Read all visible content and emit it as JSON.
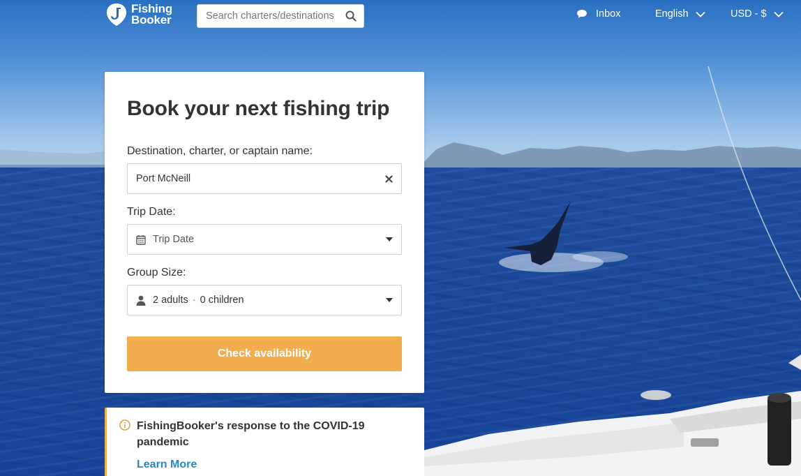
{
  "header": {
    "logo_line1": "Fishing",
    "logo_line2": "Booker",
    "search_placeholder": "Search charters/destinations",
    "inbox_label": "Inbox",
    "language_label": "English",
    "currency_label": "USD - $"
  },
  "booking": {
    "title": "Book your next fishing trip",
    "destination_label": "Destination, charter, or captain name:",
    "destination_value": "Port McNeill",
    "date_label": "Trip Date:",
    "date_placeholder": "Trip Date",
    "group_label": "Group Size:",
    "adults_text": "2 adults",
    "separator": "·",
    "children_text": "0 children",
    "check_button": "Check availability"
  },
  "notice": {
    "title": "FishingBooker's response to the COVID-19 pandemic",
    "link": "Learn More"
  },
  "colors": {
    "accent": "#f1ad4e",
    "link": "#2a86c6",
    "text": "#333333"
  }
}
